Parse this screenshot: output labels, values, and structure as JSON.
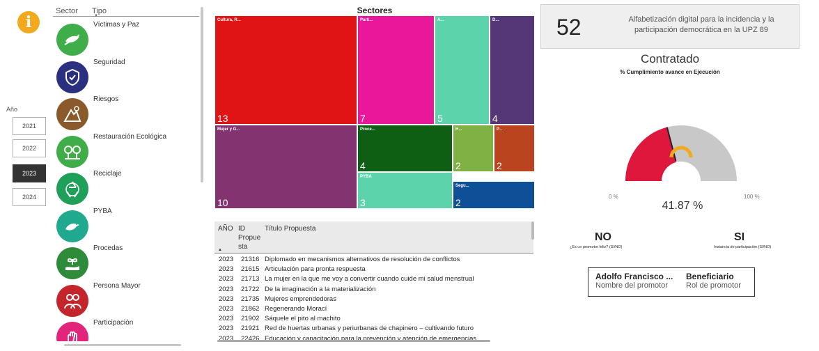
{
  "info_icon": "i",
  "year_slicer": {
    "label": "Año",
    "options": [
      "2021",
      "2022",
      "2023",
      "2024"
    ],
    "selected": "2023"
  },
  "sector_list": {
    "col_sector": "Sector",
    "col_tipo": "Tipo",
    "items": [
      {
        "label": "Víctimas y Paz",
        "color": "#3fae49",
        "icon": "dove-icon"
      },
      {
        "label": "Seguridad",
        "color": "#2b2f80",
        "icon": "shield-icon"
      },
      {
        "label": "Riesgos",
        "color": "#8b5a2b",
        "icon": "landslide-icon"
      },
      {
        "label": "Restauración Ecológica",
        "color": "#3fae49",
        "icon": "trees-icon"
      },
      {
        "label": "Reciclaje",
        "color": "#1f9f5a",
        "icon": "recycle-icon"
      },
      {
        "label": "PYBA",
        "color": "#20a98e",
        "icon": "bird-icon"
      },
      {
        "label": "Procedas",
        "color": "#2e8b3a",
        "icon": "plant-hand-icon"
      },
      {
        "label": "Persona Mayor",
        "color": "#c4252b",
        "icon": "elderly-icon"
      },
      {
        "label": "Participación",
        "color": "#e2247a",
        "icon": "raised-hands-icon"
      }
    ]
  },
  "treemap": {
    "title": "Sectores",
    "tiles": [
      {
        "label": "Cultura, R...",
        "value": "13",
        "color": "#e01414"
      },
      {
        "label": "Parti...",
        "value": "7",
        "color": "#e9179a"
      },
      {
        "label": "A...",
        "value": "5",
        "color": "#5dd3ac"
      },
      {
        "label": "D...",
        "value": "4",
        "color": "#553677"
      },
      {
        "label": "Mujer y G...",
        "value": "10",
        "color": "#833470"
      },
      {
        "label": "Proce...",
        "value": "4",
        "color": "#0e5f14"
      },
      {
        "label": "H...",
        "value": "2",
        "color": "#80b144"
      },
      {
        "label": "P...",
        "value": "2",
        "color": "#b9441d"
      },
      {
        "label": "PYBA",
        "value": "3",
        "color": "#5dd3ac"
      },
      {
        "label": "Segu...",
        "value": "2",
        "color": "#0f4f97"
      }
    ]
  },
  "table": {
    "headers": {
      "year": "AÑO",
      "id": "ID Propue sta",
      "title": "Título Propuesta"
    },
    "rows": [
      {
        "year": "2023",
        "id": "21316",
        "title": "Diplomado en mecanismos alternativos de resolución de conflictos"
      },
      {
        "year": "2023",
        "id": "21615",
        "title": "Articulación para pronta respuesta"
      },
      {
        "year": "2023",
        "id": "21713",
        "title": "La mujer en la que me voy a convertir cuando cuide mi salud menstrual"
      },
      {
        "year": "2023",
        "id": "21722",
        "title": "De la imaginación a la materialización"
      },
      {
        "year": "2023",
        "id": "21735",
        "title": "Mujeres emprendedoras"
      },
      {
        "year": "2023",
        "id": "21862",
        "title": "Regenerando Morací"
      },
      {
        "year": "2023",
        "id": "21902",
        "title": "Sáquele el pito al machito"
      },
      {
        "year": "2023",
        "id": "21921",
        "title": "Red de huertas urbanas y periurbanas de chapinero – cultivando futuro"
      },
      {
        "year": "2023",
        "id": "22426",
        "title": "Educación y capacitación para la prevención y atención de emergencias"
      }
    ]
  },
  "detail": {
    "number": "52",
    "title": "Alfabetización digital para la incidencia y la participación democrática en la UPZ 89",
    "status": "Contratado",
    "gauge_title": "% Cumplimiento avance en Ejecución",
    "gauge_value": 41.87,
    "gauge_value_text": "41.87 %",
    "gauge_min": "0 %",
    "gauge_max": "100 %",
    "gauge_fill_color": "#e0173d",
    "gauge_track_color": "#c8c8c8",
    "promotor_feliz": {
      "value": "NO",
      "label": "¿Es un promotor feliz? (SI/NO)"
    },
    "instancia": {
      "value": "SI",
      "label": "Instancia de participación (SI/NO)"
    },
    "promotor_name": "Adolfo Francisco ...",
    "promotor_name_label": "Nombre del promotor",
    "promotor_role": "Beneficiario",
    "promotor_role_label": "Rol de promotor"
  }
}
